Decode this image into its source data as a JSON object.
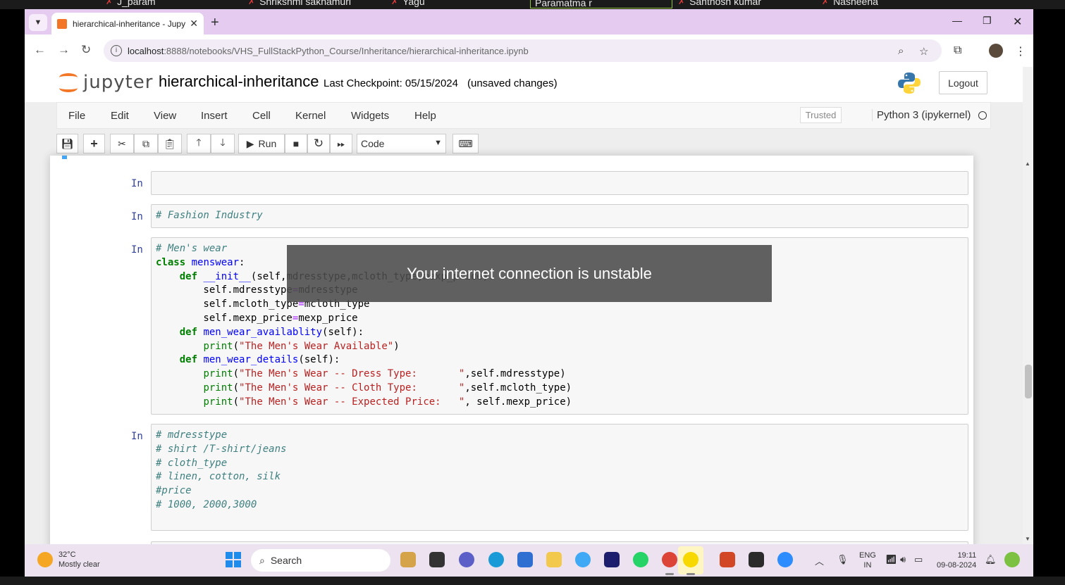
{
  "meeting": {
    "participants": [
      "J_param",
      "Shrikshmi sakhamuri",
      "Yagu",
      "Paramatma r",
      "Santhosh kumar",
      "Nasheena"
    ]
  },
  "browser": {
    "tab_title": "hierarchical-inheritance - Jupyter",
    "url_host": "localhost",
    "url_path": ":8888/notebooks/VHS_FullStackPython_Course/Inheritance/hierarchical-inheritance.ipynb"
  },
  "jupyter": {
    "logo_text": "jupyter",
    "notebook_name": "hierarchical-inheritance",
    "checkpoint": "Last Checkpoint: 05/15/2024",
    "unsaved": "(unsaved changes)",
    "logout_label": "Logout",
    "menu": [
      "File",
      "Edit",
      "View",
      "Insert",
      "Cell",
      "Kernel",
      "Widgets",
      "Help"
    ],
    "trusted": "Trusted",
    "kernel": "Python 3 (ipykernel)",
    "run_label": "Run",
    "cell_type": "Code"
  },
  "cells": {
    "prompt": "In [ ]:",
    "c2": "# Fashion Industry",
    "c4": [
      "# mdresstype",
      "# shirt /T-shirt/jeans",
      "# cloth_type",
      "# linen, cotton, silk",
      "#price",
      "# 1000, 2000,3000"
    ]
  },
  "toast": {
    "message": "Your internet connection is unstable"
  },
  "taskbar": {
    "temp": "32°C",
    "weather": "Mostly clear",
    "search": "Search",
    "lang1": "ENG",
    "lang2": "IN",
    "time": "19:11",
    "date": "09-08-2024"
  }
}
